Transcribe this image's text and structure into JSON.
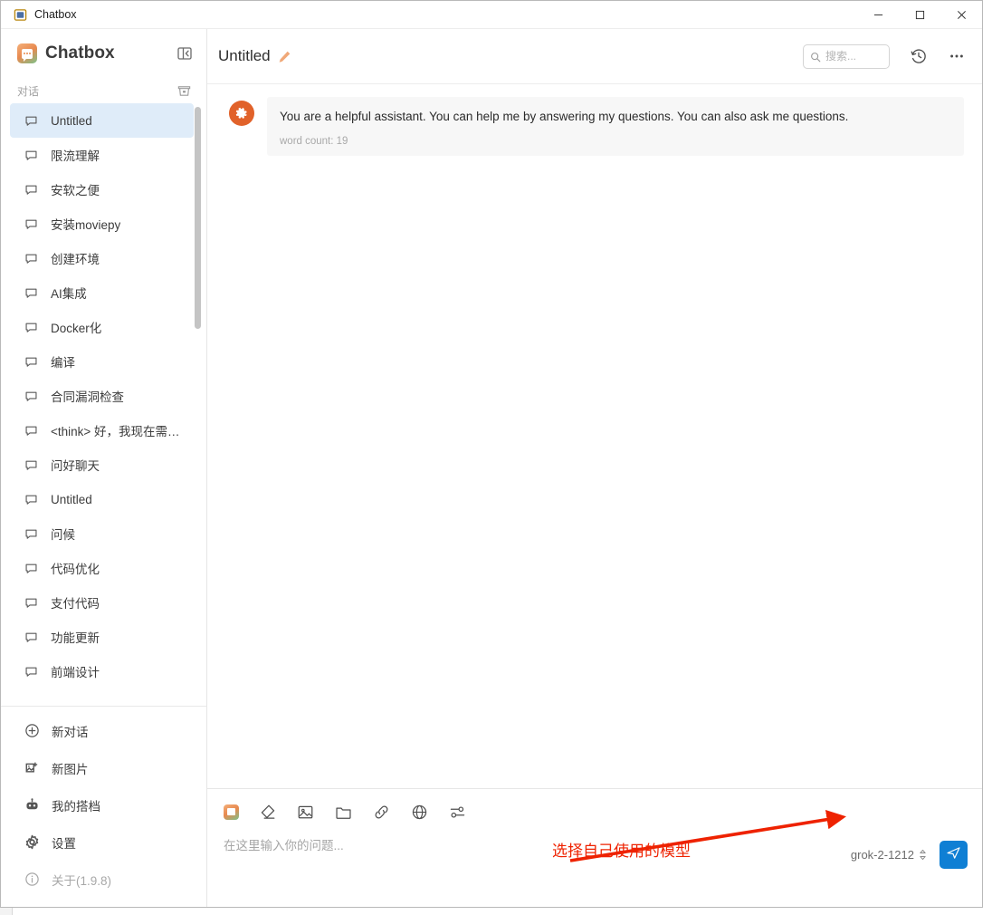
{
  "window": {
    "title": "Chatbox",
    "app_icon": "app-window-icon",
    "controls": {
      "minimize": "─",
      "maximize": "□",
      "close": "✕"
    }
  },
  "sidebar": {
    "brand": "Chatbox",
    "brand_logo_icon": "chatbox-logo-icon",
    "collapse_icon": "collapse-sidebar-icon",
    "section_label": "对话",
    "clear_icon": "clear-conversations-icon",
    "conversations": [
      {
        "label": "Untitled",
        "active": true
      },
      {
        "label": "限流理解",
        "active": false
      },
      {
        "label": "安软之便",
        "active": false
      },
      {
        "label": "安装moviepy",
        "active": false
      },
      {
        "label": "创建环境",
        "active": false
      },
      {
        "label": "AI集成",
        "active": false
      },
      {
        "label": "Docker化",
        "active": false
      },
      {
        "label": "编译",
        "active": false
      },
      {
        "label": "合同漏洞检查",
        "active": false
      },
      {
        "label": "<think> 好，我现在需…",
        "active": false
      },
      {
        "label": "问好聊天",
        "active": false
      },
      {
        "label": "Untitled",
        "active": false
      },
      {
        "label": "问候",
        "active": false
      },
      {
        "label": "代码优化",
        "active": false
      },
      {
        "label": "支付代码",
        "active": false
      },
      {
        "label": "功能更新",
        "active": false
      },
      {
        "label": "前端设计",
        "active": false
      }
    ],
    "nav": [
      {
        "label": "新对话",
        "icon": "plus-circle-icon",
        "muted": false
      },
      {
        "label": "新图片",
        "icon": "new-image-icon",
        "muted": false
      },
      {
        "label": "我的搭档",
        "icon": "robot-icon",
        "muted": false
      },
      {
        "label": "设置",
        "icon": "gear-icon",
        "muted": false
      },
      {
        "label": "关于(1.9.8)",
        "icon": "info-icon",
        "muted": true
      }
    ]
  },
  "main": {
    "chat_title": "Untitled",
    "edit_icon": "pencil-icon",
    "search": {
      "placeholder": "搜索...",
      "value": "",
      "icon": "search-icon"
    },
    "history_icon": "history-clock-icon",
    "more_icon": "more-horizontal-icon",
    "messages": [
      {
        "role": "system",
        "avatar_icon": "gear-avatar-icon",
        "text": "You are a helpful assistant. You can help me by answering my questions. You can also ask me questions.",
        "meta": "word count: 19"
      }
    ]
  },
  "composer": {
    "tools": [
      {
        "name": "chatbox-logo-icon",
        "label": "Chatbox"
      },
      {
        "name": "eraser-icon",
        "label": "Clear"
      },
      {
        "name": "image-icon",
        "label": "Image"
      },
      {
        "name": "folder-icon",
        "label": "File"
      },
      {
        "name": "link-icon",
        "label": "Link"
      },
      {
        "name": "globe-icon",
        "label": "Web"
      },
      {
        "name": "sliders-icon",
        "label": "Settings"
      }
    ],
    "input_placeholder": "在这里输入你的问题...",
    "input_value": "",
    "model": "grok-2-1212",
    "model_chevron_icon": "chevron-up-down-icon",
    "send_icon": "send-icon"
  },
  "annotation": {
    "text": "选择自己使用的模型",
    "color": "#ee2200",
    "arrow_icon": "red-arrow-icon"
  },
  "colors": {
    "accent_blue": "#0f7fd4",
    "active_item_bg": "#dfecf9",
    "avatar_orange": "#e1622a",
    "annotation_red": "#ee2200"
  }
}
